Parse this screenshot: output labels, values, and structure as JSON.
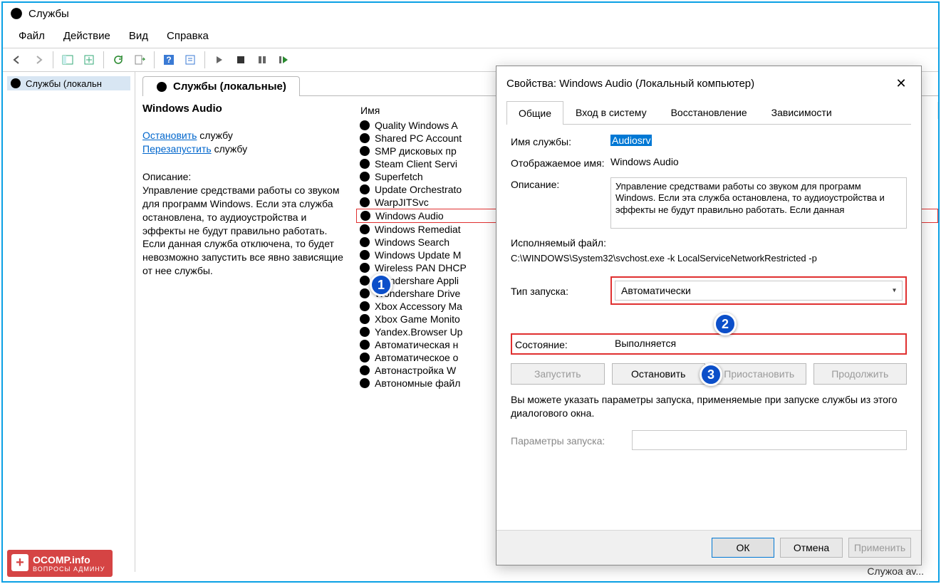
{
  "app": {
    "title": "Службы"
  },
  "menubar": {
    "file": "Файл",
    "action": "Действие",
    "view": "Вид",
    "help": "Справка"
  },
  "tree": {
    "root": "Службы (локальн"
  },
  "content_tab": "Службы (локальные)",
  "detail": {
    "title": "Windows Audio",
    "stop_link": "Остановить",
    "stop_suffix": " службу",
    "restart_link": "Перезапустить",
    "restart_suffix": " службу",
    "desc_label": "Описание:",
    "desc": "Управление средствами работы со звуком для программ Windows. Если эта служба остановлена, то аудиоустройства и эффекты не будут правильно работать. Если данная служба отключена, то будет невозможно запустить все явно зависящие от нее службы."
  },
  "list": {
    "header": "Имя",
    "items": [
      {
        "name": "Quality Windows A"
      },
      {
        "name": "Shared PC Account"
      },
      {
        "name": "SMP дисковых пр"
      },
      {
        "name": "Steam Client Servi"
      },
      {
        "name": "Superfetch"
      },
      {
        "name": "Update Orchestrato"
      },
      {
        "name": "WarpJITSvc"
      },
      {
        "name": "Windows Audio",
        "selected": true
      },
      {
        "name": "Windows Remediat"
      },
      {
        "name": "Windows Search"
      },
      {
        "name": "Windows Update M"
      },
      {
        "name": "Wireless PAN DHCP"
      },
      {
        "name": "Wondershare Appli"
      },
      {
        "name": "Wondershare Drive"
      },
      {
        "name": "Xbox Accessory Ma"
      },
      {
        "name": "Xbox Game Monito"
      },
      {
        "name": "Yandex.Browser Up"
      },
      {
        "name": "Автоматическая н"
      },
      {
        "name": "Автоматическое о"
      },
      {
        "name": "Автонастройка W"
      },
      {
        "name": "Автономные файл"
      }
    ]
  },
  "dialog": {
    "title": "Свойства: Windows Audio (Локальный компьютер)",
    "tabs": {
      "general": "Общие",
      "logon": "Вход в систему",
      "recovery": "Восстановление",
      "deps": "Зависимости"
    },
    "svc_name_lbl": "Имя службы:",
    "svc_name": "Audiosrv",
    "disp_name_lbl": "Отображаемое имя:",
    "disp_name": "Windows Audio",
    "desc_lbl": "Описание:",
    "desc": "Управление средствами работы со звуком для программ Windows. Если эта служба остановлена, то аудиоустройства и эффекты не будут правильно работать. Если данная",
    "exe_lbl": "Исполняемый файл:",
    "exe": "C:\\WINDOWS\\System32\\svchost.exe -k LocalServiceNetworkRestricted -p",
    "startup_lbl": "Тип запуска:",
    "startup": "Автоматически",
    "state_lbl": "Состояние:",
    "state": "Выполняется",
    "btn_start": "Запустить",
    "btn_stop": "Остановить",
    "btn_pause": "Приостановить",
    "btn_resume": "Продолжить",
    "hint": "Вы можете указать параметры запуска, применяемые при запуске службы из этого диалогового окна.",
    "params_lbl": "Параметры запуска:",
    "ok": "ОК",
    "cancel": "Отмена",
    "apply": "Применить"
  },
  "annot": {
    "b1": "1",
    "b2": "2",
    "b3": "3"
  },
  "watermark": {
    "main": "OCOMP.info",
    "sub": "ВОПРОСЫ АДМИНУ"
  },
  "status_right": "Служоа av..."
}
